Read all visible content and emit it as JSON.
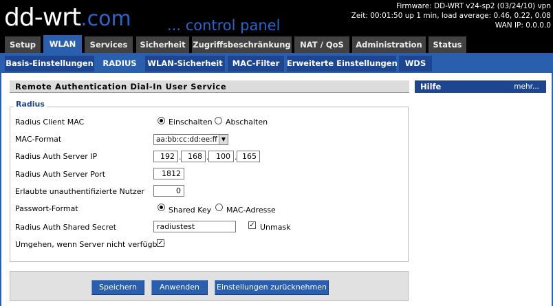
{
  "header": {
    "logo_main": "dd-wrt",
    "logo_suffix": ".com",
    "tagline": "... control panel",
    "firmware": "Firmware: DD-WRT v24-sp2 (03/24/10) vpn",
    "uptime": "Zeit: 00:01:50 up 1 min, load average: 0.46, 0.22, 0.08",
    "wan_ip": "WAN IP: 0.0.0.0"
  },
  "main_tabs": [
    "Setup",
    "WLAN",
    "Services",
    "Sicherheit",
    "Zugriffsbeschränkung",
    "NAT / QoS",
    "Administration",
    "Status"
  ],
  "sub_tabs": [
    "Basis-Einstellungen",
    "RADIUS",
    "WLAN-Sicherheit",
    "MAC-Filter",
    "Erweiterte Einstellungen",
    "WDS"
  ],
  "section_title": "Remote Authentication Dial-In User Service",
  "legend": "Radius",
  "fields": {
    "client_mac_label": "Radius Client MAC",
    "enable_label": "Einschalten",
    "disable_label": "Abschalten",
    "mac_format_label": "MAC-Format",
    "mac_format_value": "aa:bb:cc:dd:ee:ff",
    "server_ip_label": "Radius Auth Server IP",
    "ip": [
      "192",
      "168",
      "100",
      "165"
    ],
    "server_port_label": "Radius Auth Server Port",
    "server_port_value": "1812",
    "unauth_users_label": "Erlaubte unauthentifizierte Nutzer",
    "unauth_users_value": "0",
    "password_format_label": "Passwort-Format",
    "shared_key_label": "Shared Key",
    "mac_address_label": "MAC-Adresse",
    "shared_secret_label": "Radius Auth Shared Secret",
    "shared_secret_value": "radiustest",
    "unmask_label": "Unmask",
    "bypass_label": "Umgehen, wenn Server nicht verfügbar"
  },
  "help": {
    "title": "Hilfe",
    "more": "mehr..."
  },
  "buttons": {
    "save": "Speichern",
    "apply": "Anwenden",
    "reset": "Einstellungen zurücknehmen"
  }
}
